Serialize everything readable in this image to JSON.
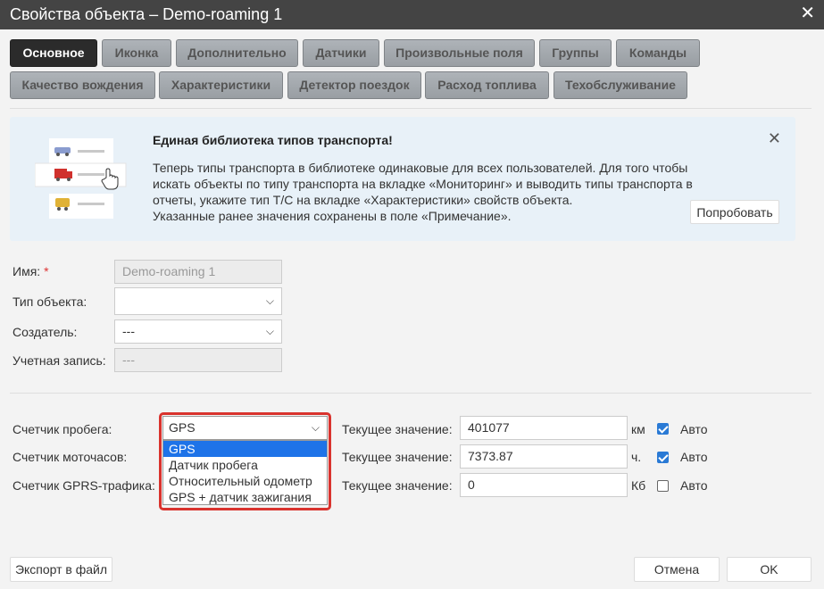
{
  "window": {
    "title": "Свойства объекта – Demo-roaming 1",
    "close": "✕"
  },
  "tabs": [
    {
      "label": "Основное"
    },
    {
      "label": "Иконка"
    },
    {
      "label": "Дополнительно"
    },
    {
      "label": "Датчики"
    },
    {
      "label": "Произвольные поля"
    },
    {
      "label": "Группы"
    },
    {
      "label": "Команды"
    },
    {
      "label": "Качество вождения"
    },
    {
      "label": "Характеристики"
    },
    {
      "label": "Детектор поездок"
    },
    {
      "label": "Расход топлива"
    },
    {
      "label": "Техобслуживание"
    }
  ],
  "banner": {
    "title": "Единая библиотека типов транспорта!",
    "lines": [
      "Теперь типы транспорта в библиотеке одинаковые для всех пользователей. Для того чтобы",
      "искать объекты по типу транспорта на вкладке «Мониторинг» и выводить типы транспорта в",
      "отчеты, укажите тип Т/С на вкладке «Характеристики» свойств объекта.",
      "Указанные ранее значения сохранены в поле «Примечание»."
    ],
    "try_label": "Попробовать",
    "close": "✕"
  },
  "form": {
    "name_label": "Имя:",
    "name_required": "*",
    "name_value": "Demo-roaming 1",
    "type_label": "Тип объекта:",
    "type_value": "",
    "creator_label": "Создатель:",
    "creator_value": "---",
    "account_label": "Учетная запись:",
    "account_value": "---"
  },
  "counters": {
    "mileage_label": "Счетчик пробега:",
    "engine_label": "Счетчик моточасов:",
    "gprs_label": "Счетчик GPRS-трафика:",
    "current_label": "Текущее значение:",
    "auto_label": "Авто",
    "mileage_value": "401077",
    "mileage_unit": "км",
    "mileage_auto": true,
    "engine_value": "7373.87",
    "engine_unit": "ч.",
    "engine_auto": true,
    "gprs_value": "0",
    "gprs_unit": "Кб",
    "gprs_auto": false
  },
  "dropdown": {
    "selected": "GPS",
    "options": [
      "GPS",
      "Датчик пробега",
      "Относительный одометр",
      "GPS + датчик зажигания"
    ]
  },
  "footer": {
    "export_label": "Экспорт в файл",
    "cancel_label": "Отмена",
    "ok_label": "OK"
  },
  "colors": {
    "titlebar": "#444444",
    "active_tab": "#2b2b2b",
    "banner_bg": "#e8f1f8",
    "highlight": "#d9332e",
    "selected_option": "#1e73e8",
    "checkbox": "#2a7ad5"
  }
}
